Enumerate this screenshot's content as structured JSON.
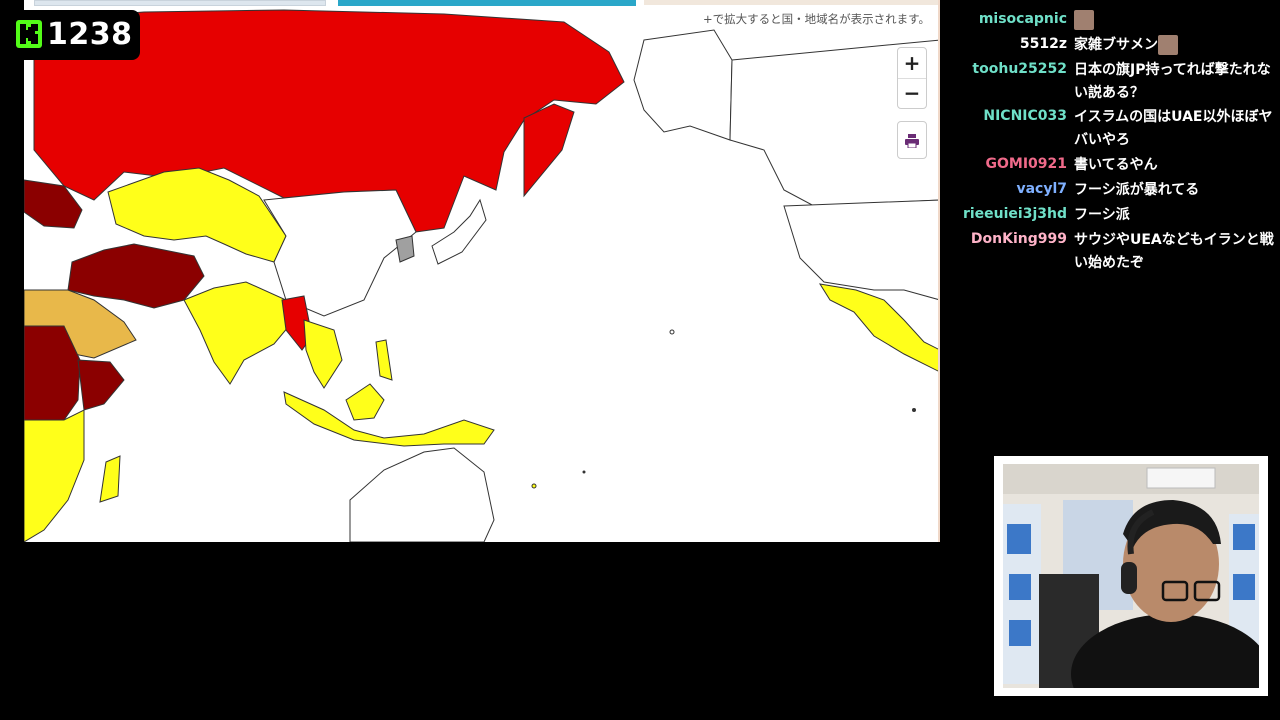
{
  "viewer_counter": {
    "count": "1238",
    "logo": "kick-logo-icon",
    "logo_color": "#53fc18"
  },
  "map": {
    "hint": "+で拡大すると国・地域名が表示されます。",
    "zoom_in": "+",
    "zoom_out": "−",
    "print_icon": "printer-icon",
    "colors": {
      "level_4_dark_red": "#8b0000",
      "level_3_red": "#e60000",
      "level_2_orange": "#e8b84a",
      "level_1_yellow": "#ffff1a",
      "grey": "#a0a0a0",
      "none": "#ffffff"
    }
  },
  "chat": {
    "messages": [
      {
        "user": "misocapnic",
        "color": "#6fe0c8",
        "text": "",
        "emote": true
      },
      {
        "user": "5512z",
        "color": "#ffffff",
        "text": "家雑ブサメン",
        "emote": true
      },
      {
        "user": "toohu25252",
        "color": "#6fe0c8",
        "text": "日本の旗JP持ってれば撃たれない説ある？",
        "emote": false
      },
      {
        "user": "NICNIC033",
        "color": "#6fe0c8",
        "text": "イスラムの国はUAE以外ほぼヤバいやろ",
        "emote": false
      },
      {
        "user": "GOMI0921",
        "color": "#f06a8a",
        "text": "書いてるやん",
        "emote": false
      },
      {
        "user": "vacyl7",
        "color": "#7fb0ff",
        "text": "フーシ派が暴れてる",
        "emote": false
      },
      {
        "user": "rieeuiei3j3hd",
        "color": "#6fe0c8",
        "text": "フーシ派",
        "emote": false
      },
      {
        "user": "DonKing999",
        "color": "#ffb3c8",
        "text": "サウジやUEAなどもイランと戦い始めたぞ",
        "emote": false
      }
    ]
  }
}
